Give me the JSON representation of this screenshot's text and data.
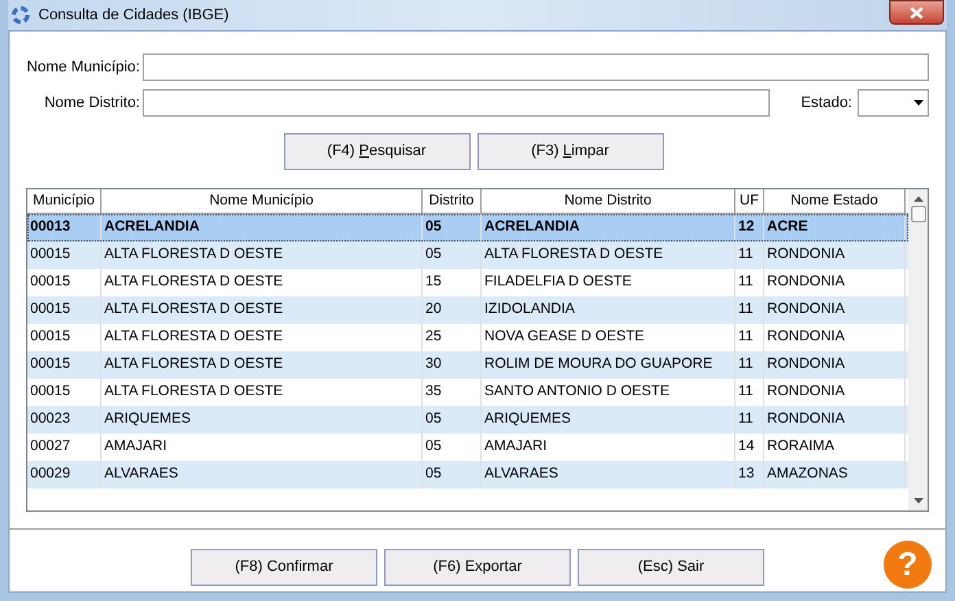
{
  "window": {
    "title": "Consulta de Cidades (IBGE)"
  },
  "filters": {
    "municipio_label": "Nome Município:",
    "distrito_label": "Nome Distrito:",
    "estado_label": "Estado:"
  },
  "search_buttons": [
    {
      "before": "(F4) ",
      "mnemonic": "P",
      "after": "esquisar"
    },
    {
      "before": "(F3) ",
      "mnemonic": "L",
      "after": "impar"
    }
  ],
  "table": {
    "columns": [
      "Município",
      "Nome Município",
      "Distrito",
      "Nome Distrito",
      "UF",
      "Nome Estado"
    ],
    "rows": [
      {
        "selected": true,
        "cells": [
          "00013",
          "ACRELANDIA",
          "05",
          "ACRELANDIA",
          "12",
          "ACRE"
        ]
      },
      {
        "selected": false,
        "cells": [
          "00015",
          "ALTA FLORESTA D OESTE",
          "05",
          "ALTA FLORESTA D OESTE",
          "11",
          "RONDONIA"
        ]
      },
      {
        "selected": false,
        "cells": [
          "00015",
          "ALTA FLORESTA D OESTE",
          "15",
          "FILADELFIA D OESTE",
          "11",
          "RONDONIA"
        ]
      },
      {
        "selected": false,
        "cells": [
          "00015",
          "ALTA FLORESTA D OESTE",
          "20",
          "IZIDOLANDIA",
          "11",
          "RONDONIA"
        ]
      },
      {
        "selected": false,
        "cells": [
          "00015",
          "ALTA FLORESTA D OESTE",
          "25",
          "NOVA GEASE D OESTE",
          "11",
          "RONDONIA"
        ]
      },
      {
        "selected": false,
        "cells": [
          "00015",
          "ALTA FLORESTA D OESTE",
          "30",
          "ROLIM DE MOURA DO GUAPORE",
          "11",
          "RONDONIA"
        ]
      },
      {
        "selected": false,
        "cells": [
          "00015",
          "ALTA FLORESTA D OESTE",
          "35",
          "SANTO ANTONIO D OESTE",
          "11",
          "RONDONIA"
        ]
      },
      {
        "selected": false,
        "cells": [
          "00023",
          "ARIQUEMES",
          "05",
          "ARIQUEMES",
          "11",
          "RONDONIA"
        ]
      },
      {
        "selected": false,
        "cells": [
          "00027",
          "AMAJARI",
          "05",
          "AMAJARI",
          "14",
          "RORAIMA"
        ]
      },
      {
        "selected": false,
        "cells": [
          "00029",
          "ALVARAES",
          "05",
          "ALVARAES",
          "13",
          "AMAZONAS"
        ]
      }
    ]
  },
  "footer_buttons": [
    "(F8) Confirmar",
    "(F6) Exportar",
    "(Esc) Sair"
  ],
  "help": {
    "glyph": "?"
  }
}
